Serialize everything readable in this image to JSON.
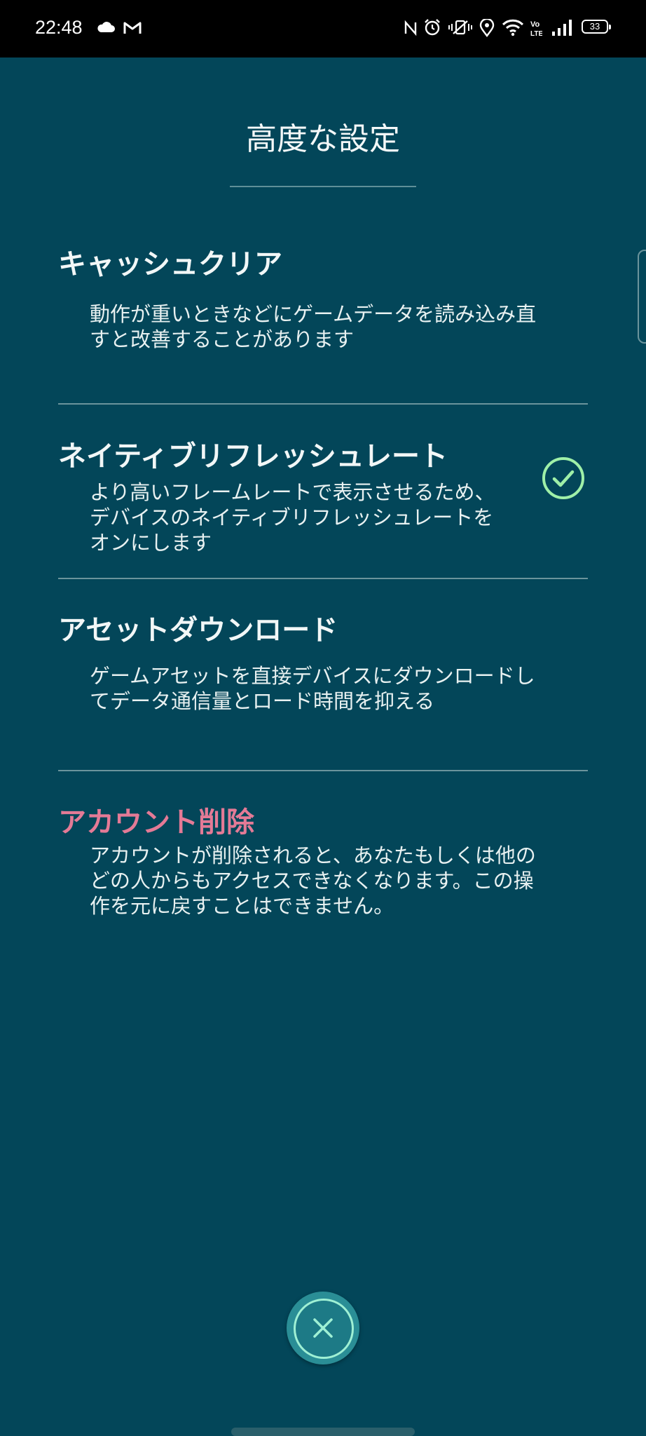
{
  "status_bar": {
    "time": "22:48",
    "left_icons": [
      "cloud-icon",
      "gmail-icon"
    ],
    "right_icons": [
      "nfc-icon",
      "alarm-icon",
      "vibrate-off-icon",
      "location-icon",
      "wifi-icon",
      "volte-icon",
      "signal-icon"
    ],
    "battery_level": "33"
  },
  "page": {
    "title": "高度な設定"
  },
  "settings": [
    {
      "title": "キャッシュクリア",
      "description": [
        "動作が重いときなどにゲームデータを読み込み直",
        "すと改善することがあります"
      ]
    },
    {
      "title": "ネイティブリフレッシュレート",
      "description": [
        "より高いフレームレートで表示させるため、",
        "デバイスのネイティブリフレッシュレートを",
        "オンにします"
      ],
      "enabled": true
    },
    {
      "title": "アセットダウンロード",
      "description": [
        "ゲームアセットを直接デバイスにダウンロードし",
        "てデータ通信量とロード時間を抑える"
      ]
    },
    {
      "title": "アカウント削除",
      "description": [
        "アカウントが削除されると、あなたもしくは他の",
        "どの人からもアクセスできなくなります。この操",
        "作を元に戻すことはできません。"
      ]
    }
  ],
  "colors": {
    "background": "#034659",
    "danger_text": "#e47a96",
    "check_green": "#9ff0a8",
    "close_button": "#2a8e96"
  },
  "icons": {
    "toggle": "checkmark-circle-icon",
    "close": "close-x-icon"
  }
}
